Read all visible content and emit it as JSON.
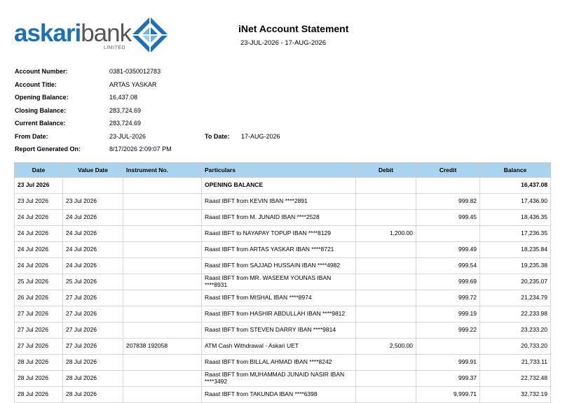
{
  "bank": {
    "name_part1": "askari",
    "name_part2": "bank",
    "limited": "LIMITED"
  },
  "header": {
    "title": "iNet Account Statement",
    "date_range": "23-JUL-2026 - 17-AUG-2026"
  },
  "account": {
    "number_label": "Account Number:",
    "number": "0381-0350012783",
    "title_label": "Account Title:",
    "title": "ARTAS YASKAR",
    "opening_label": "Opening Balance:",
    "opening": "16,437.08",
    "closing_label": "Closing Balance:",
    "closing": "283,724.69",
    "current_label": "Current Balance:",
    "current": "283,724.69",
    "from_label": "From Date:",
    "from": "23-JUL-2026",
    "to_label": "To Date:",
    "to": "17-AUG-2026",
    "generated_label": "Report Generated On:",
    "generated": "8/17/2026 2:09:07 PM"
  },
  "table": {
    "headers": [
      "Date",
      "Value Date",
      "Instrument No.",
      "Particulars",
      "Debit",
      "Credit",
      "Balance"
    ],
    "rows": [
      [
        "23 Jul 2026",
        "",
        "",
        "OPENING BALANCE",
        "",
        "",
        "16,437.08"
      ],
      [
        "23 Jul 2026",
        "23 Jul 2026",
        "",
        "Raast IBFT from KEVIN IBAN ****2891",
        "",
        "999.82",
        "17,436.90"
      ],
      [
        "24 Jul 2026",
        "24 Jul 2026",
        "",
        "Raast IBFT from M. JUNAID IBAN ****2528",
        "",
        "999.45",
        "18,436.35"
      ],
      [
        "24 Jul 2026",
        "24 Jul 2026",
        "",
        "Raast IBFT to NAYAPAY TOPUP IBAN ****8129",
        "1,200.00",
        "",
        "17,236.35"
      ],
      [
        "24 Jul 2026",
        "24 Jul 2026",
        "",
        "Raast IBFT from ARTAS YASKAR IBAN ****8721",
        "",
        "999.49",
        "18,235.84"
      ],
      [
        "24 Jul 2026",
        "24 Jul 2026",
        "",
        "Raast IBFT from SAJJAD HUSSAIN IBAN ****4982",
        "",
        "999.54",
        "19,235.38"
      ],
      [
        "25 Jul 2026",
        "25 Jul 2026",
        "",
        "Raast IBFT from MR. WASEEM YOUNAS IBAN ****8931",
        "",
        "999.69",
        "20,235.07"
      ],
      [
        "26 Jul 2026",
        "27 Jul 2026",
        "",
        "Raast IBFT from MISHAL IBAN ****8974",
        "",
        "999.72",
        "21,234.79"
      ],
      [
        "27 Jul 2026",
        "27 Jul 2026",
        "",
        "Raast IBFT from HASHIR ABDULLAH IBAN ****9812",
        "",
        "999.19",
        "22,233.98"
      ],
      [
        "27 Jul 2026",
        "27 Jul 2026",
        "",
        "Raast IBFT from STEVEN DARRY IBAN ****9814",
        "",
        "999.22",
        "23,233.20"
      ],
      [
        "27 Jul 2026",
        "27 Jul 2026",
        "207838 192058",
        "ATM Cash Withdrawal - Askari UET",
        "2,500.00",
        "",
        "20,733.20"
      ],
      [
        "28 Jul 2026",
        "28 Jul 2026",
        "",
        "Raast IBFT from BILLAL AHMAD IBAN ****8242",
        "",
        "999.91",
        "21,733.11"
      ],
      [
        "28 Jul 2026",
        "28 Jul 2026",
        "",
        "Raast IBFT from MUHAMMAD JUNAID NASIR IBAN ****3492",
        "",
        "999.37",
        "22,732.48"
      ],
      [
        "28 Jul 2026",
        "28 Jul 2026",
        "",
        "Raast IBFT from TAKUNDA IBAN ****6398",
        "",
        "9,999.71",
        "32,732.19"
      ]
    ]
  },
  "colors": {
    "header_bg": "#a9d3ef",
    "brand_blue": "#1f6fb5"
  }
}
